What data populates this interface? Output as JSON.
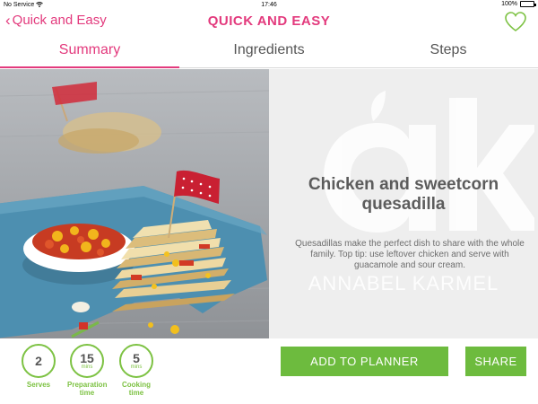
{
  "status_bar": {
    "carrier": "No Service",
    "time": "17:46",
    "battery": "100%"
  },
  "nav": {
    "back_label": "Quick and Easy",
    "title": "QUICK AND EASY"
  },
  "tabs": [
    {
      "label": "Summary",
      "active": true
    },
    {
      "label": "Ingredients",
      "active": false
    },
    {
      "label": "Steps",
      "active": false
    }
  ],
  "recipe": {
    "title": "Chicken and sweetcorn quesadilla",
    "description": "Quesadillas make the perfect dish to share with the whole family. Top tip: use leftover chicken and serve with guacamole and sour cream.",
    "watermark": "ANNABEL KARMEL"
  },
  "stats": [
    {
      "value": "2",
      "unit": "",
      "label": "Serves"
    },
    {
      "value": "15",
      "unit": "mins",
      "label": "Preparation time"
    },
    {
      "value": "5",
      "unit": "mins",
      "label": "Cooking time"
    }
  ],
  "actions": {
    "add_to_planner": "ADD TO PLANNER",
    "share": "SHARE"
  },
  "colors": {
    "accent": "#e33a7d",
    "green": "#6dbb3e",
    "panel_bg": "#eeeeee"
  }
}
